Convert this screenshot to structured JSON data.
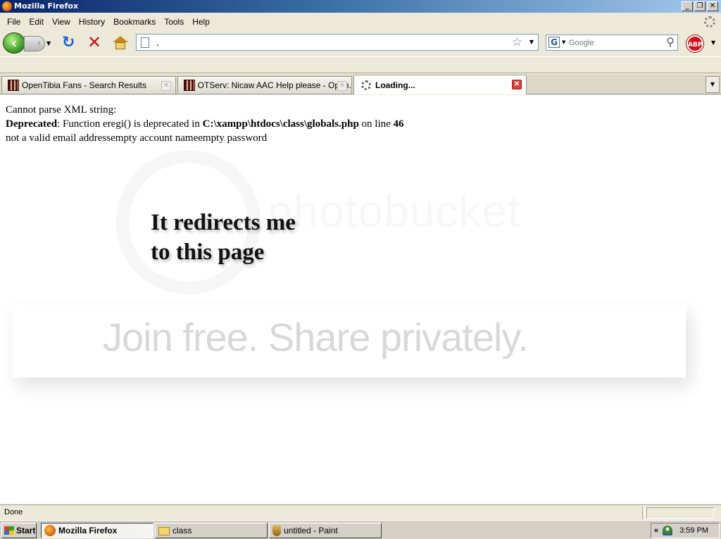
{
  "window": {
    "title": "Mozilla Firefox"
  },
  "menubar": {
    "items": [
      "File",
      "Edit",
      "View",
      "History",
      "Bookmarks",
      "Tools",
      "Help"
    ]
  },
  "navbar": {
    "url": ".",
    "search_placeholder": "Google"
  },
  "tabs": [
    {
      "label": "OpenTibia Fans - Search Results"
    },
    {
      "label": "OTServ: Nicaw AAC Help please - Open..."
    },
    {
      "label": "Loading..."
    }
  ],
  "content": {
    "line1": "Cannot parse XML string:",
    "line2_bold": "Deprecated",
    "line2_text": ": Function eregi() is deprecated in ",
    "line2_path": "C:\\xampp\\htdocs\\class\\globals.php",
    "line2_online": " on line ",
    "line2_num": "46",
    "line3": "not a valid email addressempty account nameempty password",
    "annotation_line1": "It redirects me",
    "annotation_line2": "to this page",
    "watermark_brand": "photobucket",
    "watermark_banner": "Join free. Share privately."
  },
  "statusbar": {
    "text": "Done"
  },
  "taskbar": {
    "start": "Start",
    "items": [
      "Mozilla Firefox",
      "class",
      "untitled - Paint"
    ],
    "clock": "3:59 PM"
  }
}
